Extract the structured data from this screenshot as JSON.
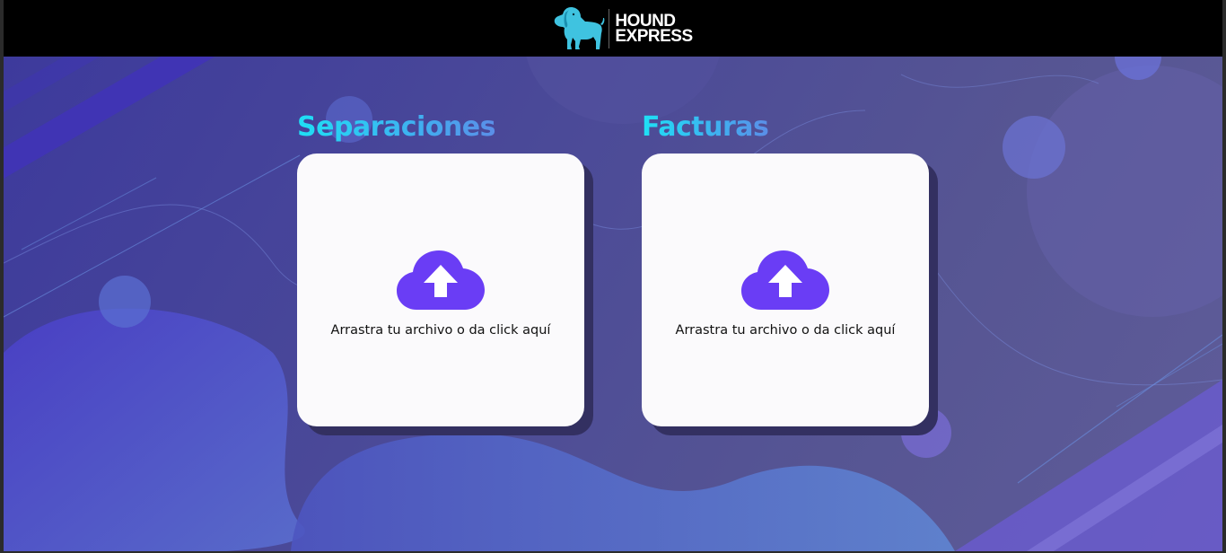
{
  "header": {
    "brand_line1": "HOUND",
    "brand_line2": "EXPRESS",
    "logo_icon": "hound-dog-icon"
  },
  "uploads": [
    {
      "title": "Separaciones",
      "hint": "Arrastra tu archivo o da click aquí",
      "icon": "cloud-upload-icon"
    },
    {
      "title": "Facturas",
      "hint": "Arrastra tu archivo o da click aquí",
      "icon": "cloud-upload-icon"
    }
  ],
  "colors": {
    "accent_title": "#1ee0f5",
    "upload_icon": "#6a3df5",
    "card_bg": "#fbfafc",
    "header_bg": "#000000"
  }
}
